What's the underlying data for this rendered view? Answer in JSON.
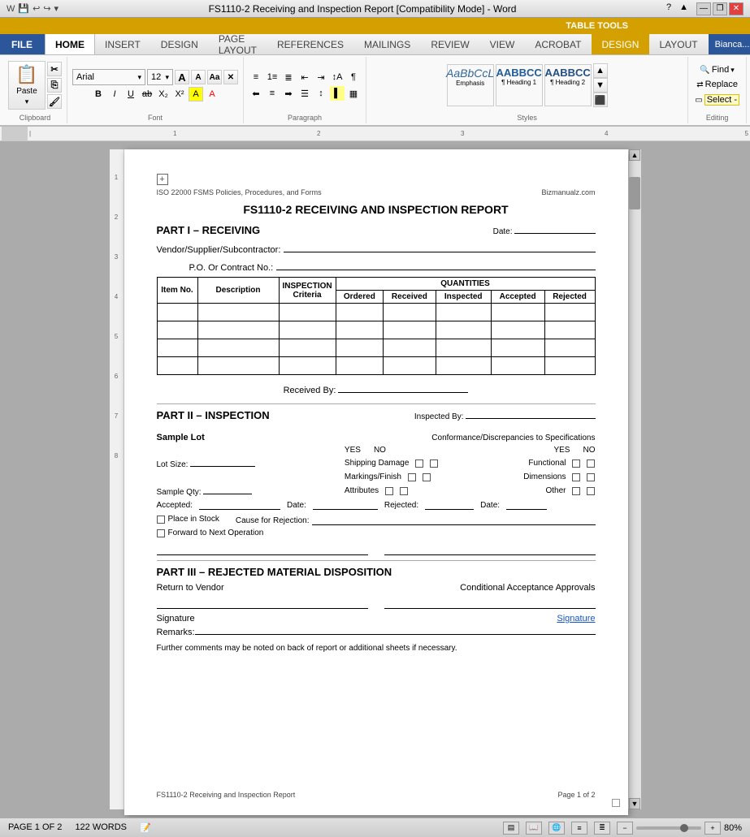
{
  "titleBar": {
    "title": "FS1110-2 Receiving and Inspection Report [Compatibility Mode] - Word",
    "tableTools": "TABLE TOOLS"
  },
  "ribbon": {
    "tabs": [
      "FILE",
      "HOME",
      "INSERT",
      "DESIGN",
      "PAGE LAYOUT",
      "REFERENCES",
      "MAILINGS",
      "REVIEW",
      "VIEW",
      "ACROBAT",
      "DESIGN",
      "LAYOUT"
    ],
    "activeTab": "HOME",
    "groups": {
      "clipboard": "Clipboard",
      "font": "Font",
      "paragraph": "Paragraph",
      "styles": "Styles",
      "editing": "Editing"
    },
    "fontName": "Arial",
    "fontSize": "12",
    "styles": [
      "Emphasis",
      "¶ Heading 1",
      "¶ Heading 2"
    ],
    "findLabel": "Find",
    "replaceLabel": "Replace",
    "selectLabel": "Select -"
  },
  "document": {
    "headerLeft": "ISO 22000 FSMS Policies, Procedures, and Forms",
    "headerRight": "Bizmanualz.com",
    "title": "FS1110-2 RECEIVING AND INSPECTION REPORT",
    "parts": {
      "part1": {
        "header": "PART I – RECEIVING",
        "dateLabel": "Date:",
        "vendorLabel": "Vendor/Supplier/Subcontractor:",
        "poLabel": "P.O. Or Contract No.:",
        "tableHeaders": {
          "itemNo": "Item No.",
          "description": "Description",
          "inspection": "INSPECTION\nCriteria",
          "quantities": "QUANTITIES",
          "ordered": "Ordered",
          "received": "Received",
          "inspected": "Inspected",
          "accepted": "Accepted",
          "rejected": "Rejected"
        },
        "receivedByLabel": "Received By:"
      },
      "part2": {
        "header": "PART II – INSPECTION",
        "inspectedByLabel": "Inspected By:",
        "sampleLotLabel": "Sample Lot",
        "conformanceLabel": "Conformance/Discrepancies to Specifications",
        "yesLabel": "YES",
        "noLabel": "NO",
        "yesLabel2": "YES",
        "noLabel2": "NO",
        "fields": [
          {
            "left": "Shipping Damage",
            "right": "Functional"
          },
          {
            "left": "Markings/Finish",
            "right": "Dimensions"
          },
          {
            "left": "Attributes",
            "right": "Other"
          }
        ],
        "lotSizeLabel": "Lot Size:",
        "sampleQtyLabel": "Sample Qty:",
        "acceptedLabel": "Accepted:",
        "dateLabel": "Date:",
        "rejectedLabel": "Rejected:",
        "date2Label": "Date:",
        "causeLabel": "Cause for Rejection:",
        "placeInStock": "Place in Stock",
        "forwardLabel": "Forward to Next Operation"
      },
      "part3": {
        "header": "PART III – REJECTED MATERIAL DISPOSITION",
        "returnLabel": "Return to Vendor",
        "conditionalLabel": "Conditional Acceptance Approvals",
        "signatureLabel": "Signature",
        "signatureLink": "Signature",
        "remarksLabel": "Remarks:",
        "furtherComments": "Further comments may be noted on back of report or additional sheets if necessary."
      }
    },
    "footer": {
      "left": "FS1110-2 Receiving and Inspection Report",
      "right": "Page 1 of 2"
    }
  },
  "statusBar": {
    "pageInfo": "PAGE 1 OF 2",
    "wordCount": "122 WORDS",
    "zoom": "80%"
  }
}
